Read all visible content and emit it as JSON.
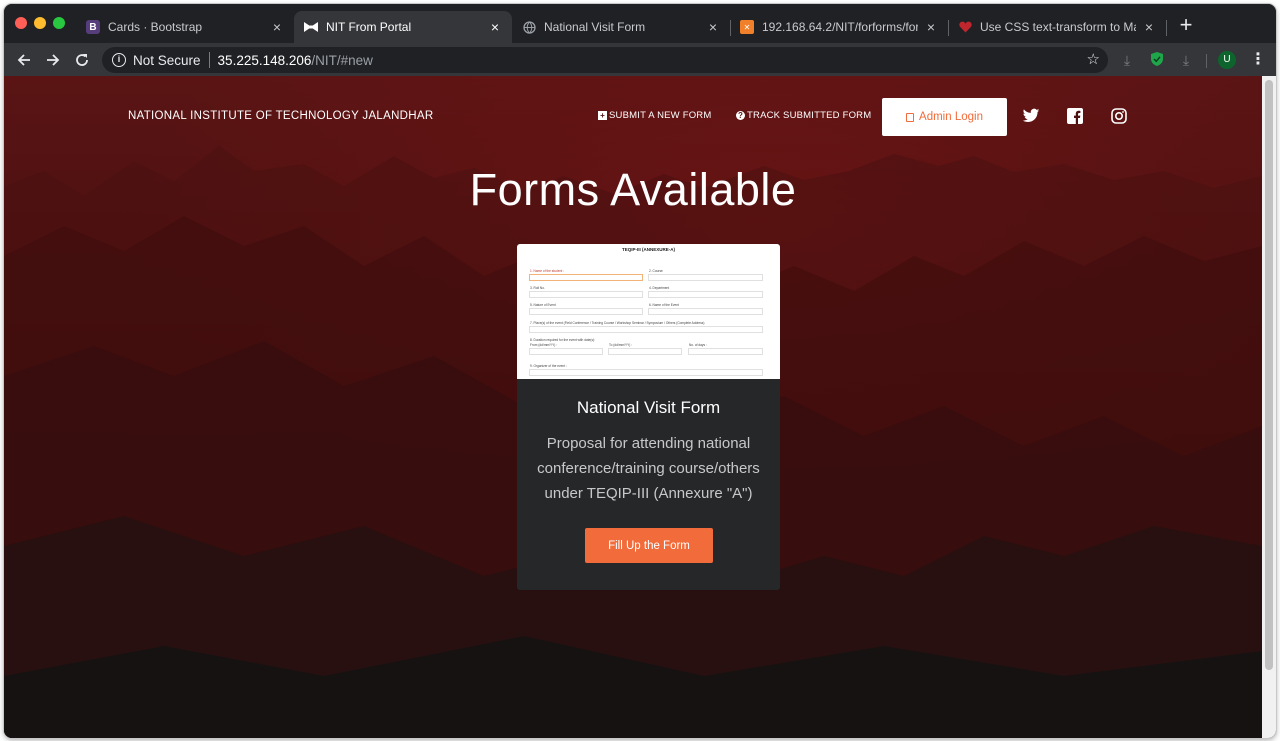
{
  "browser": {
    "tabs": [
      {
        "title": "Cards · Bootstrap",
        "favicon": "bootstrap-logo-icon",
        "active": false
      },
      {
        "title": "NIT From Portal",
        "favicon": "bowtie-icon",
        "active": true
      },
      {
        "title": "National Visit Form",
        "favicon": "globe-icon",
        "active": false
      },
      {
        "title": "192.168.64.2/NIT/forforms/form",
        "favicon": "xampp-icon",
        "active": false
      },
      {
        "title": "Use CSS text-transform to Mani",
        "favicon": "heart-icon",
        "active": false
      }
    ],
    "close_glyph": "×",
    "new_tab_glyph": "+",
    "address": {
      "security_label": "Not Secure",
      "host": "35.225.148.206",
      "path": "/NIT/#new"
    },
    "profile_initial": "U"
  },
  "page": {
    "brand": "NATIONAL INSTITUTE OF TECHNOLOGY JALANDHAR",
    "nav": {
      "submit": "SUBMIT A NEW FORM",
      "track": "TRACK SUBMITTED FORM",
      "admin": "Admin Login"
    },
    "social": [
      "twitter-icon",
      "facebook-icon",
      "instagram-icon"
    ],
    "hero_title": "Forms Available",
    "card": {
      "title": "National Visit Form",
      "text": "Proposal for attending national conference/training course/others under TEQIP-III (Annexure \"A\")",
      "button": "Fill Up the Form",
      "preview": {
        "heading": "TEQIP-III (ANNEXURE-A)",
        "fields": [
          "1. Name of the student :",
          "2. Course",
          "3. Roll No.",
          "4. Department",
          "5. Nature of Event",
          "6. Name of the Event",
          "7. Place(s) of the event (Field Conference / Training Course / Workshop Seminar / Symposium / Others (Complete Address)",
          "8. Duration required for the event with date(s):",
          "From (dd/mm/YY) :",
          "To (dd/mm/YY) :",
          "No. of days :",
          "9. Organizer of the event :"
        ]
      }
    }
  },
  "colors": {
    "accent": "#f26b3a",
    "card_bg": "#262729",
    "hero_bg": "#4e1111"
  }
}
